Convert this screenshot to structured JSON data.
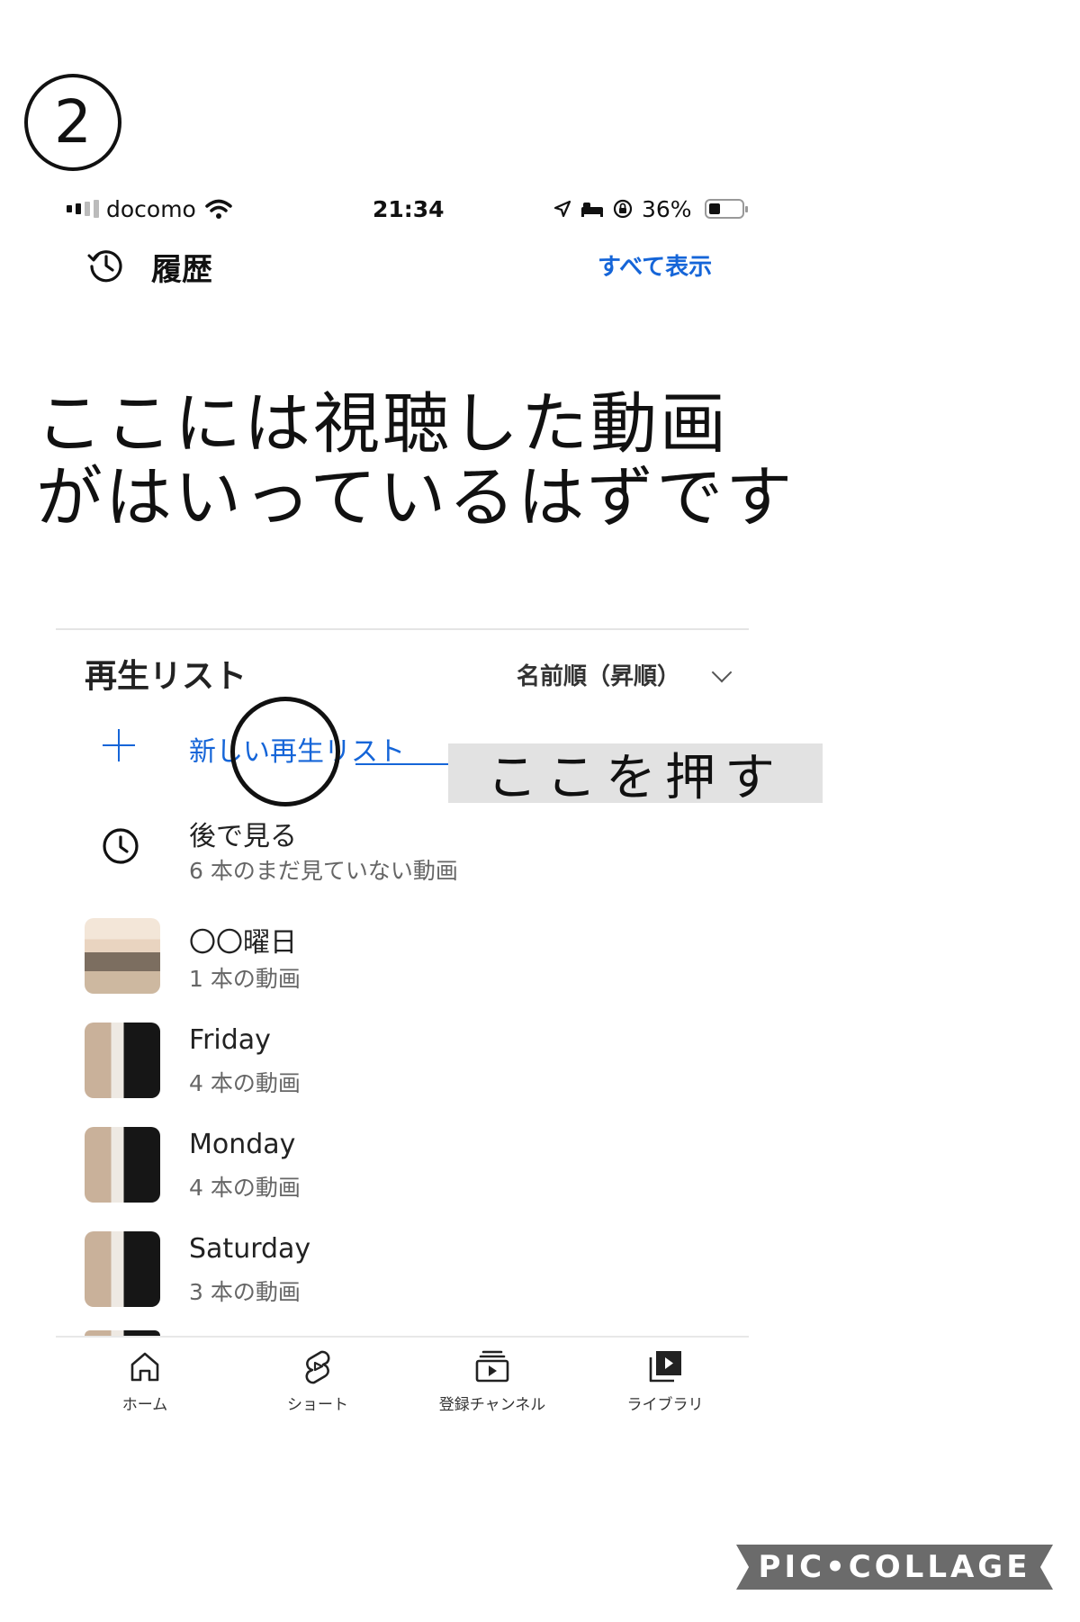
{
  "step": {
    "number": "2"
  },
  "status_bar": {
    "carrier": "docomo",
    "time": "21:34",
    "battery": "36%"
  },
  "history": {
    "title": "履歴",
    "see_all": "すべて表示"
  },
  "annotation": {
    "line1": "ここには視聴した動画",
    "line2": "がはいっているはずです",
    "callout": "ここを押す"
  },
  "playlists": {
    "title": "再生リスト",
    "sort": "名前順（昇順）",
    "new_playlist": "新しい再生リスト",
    "items": [
      {
        "title": "後で見る",
        "subtitle": "6 本のまだ見ていない動画"
      },
      {
        "title": "〇〇曜日",
        "subtitle": "1 本の動画"
      },
      {
        "title": "Friday",
        "subtitle": "4 本の動画"
      },
      {
        "title": "Monday",
        "subtitle": "4 本の動画"
      },
      {
        "title": "Saturday",
        "subtitle": "3 本の動画"
      }
    ]
  },
  "bottom_nav": {
    "home": "ホーム",
    "shorts": "ショート",
    "subscriptions": "登録チャンネル",
    "library": "ライブラリ"
  },
  "watermark": "PIC•COLLAGE",
  "colors": {
    "accent": "#1565d8",
    "callout_bg": "#e2e2e2"
  }
}
